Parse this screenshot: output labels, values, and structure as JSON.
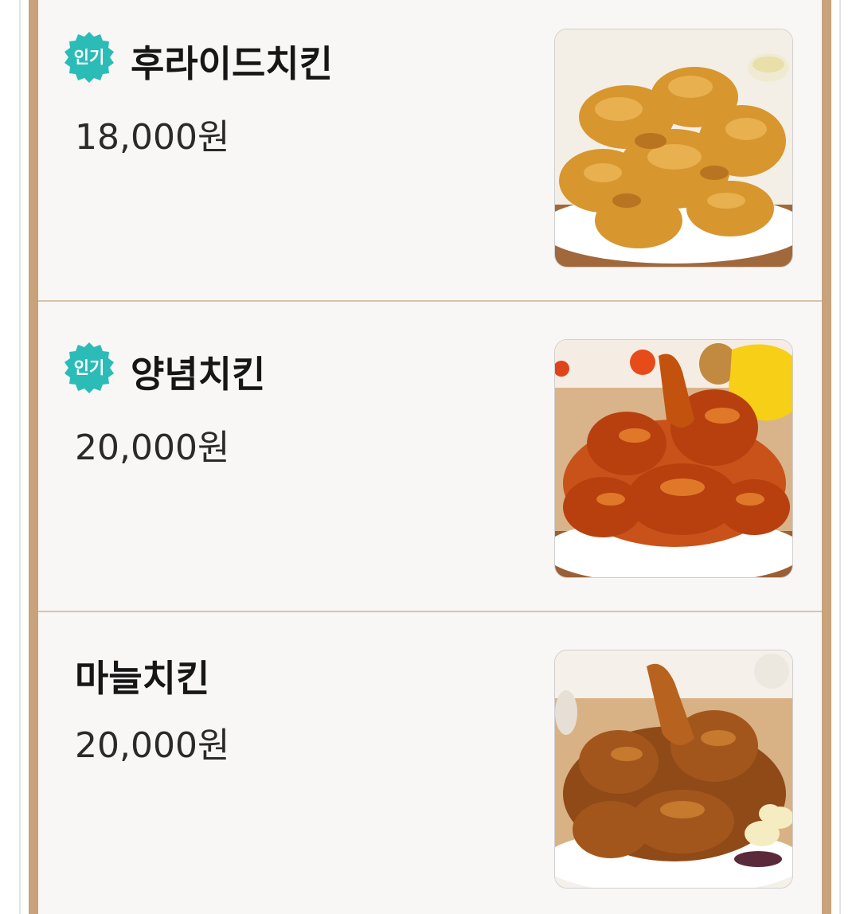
{
  "menu": {
    "items": [
      {
        "name": "후라이드치킨",
        "price": "18,000원",
        "badge": "인기",
        "image_icon": "fried-chicken-photo"
      },
      {
        "name": "양념치킨",
        "price": "20,000원",
        "badge": "인기",
        "image_icon": "yangnyeom-chicken-photo"
      },
      {
        "name": "마늘치킨",
        "price": "20,000원",
        "badge": "",
        "image_icon": "garlic-chicken-photo"
      }
    ]
  },
  "colors": {
    "badge": "#2bbcb7",
    "frame": "#c8a27a",
    "divider": "#d8c3ab",
    "background": "#f8f7f5"
  }
}
